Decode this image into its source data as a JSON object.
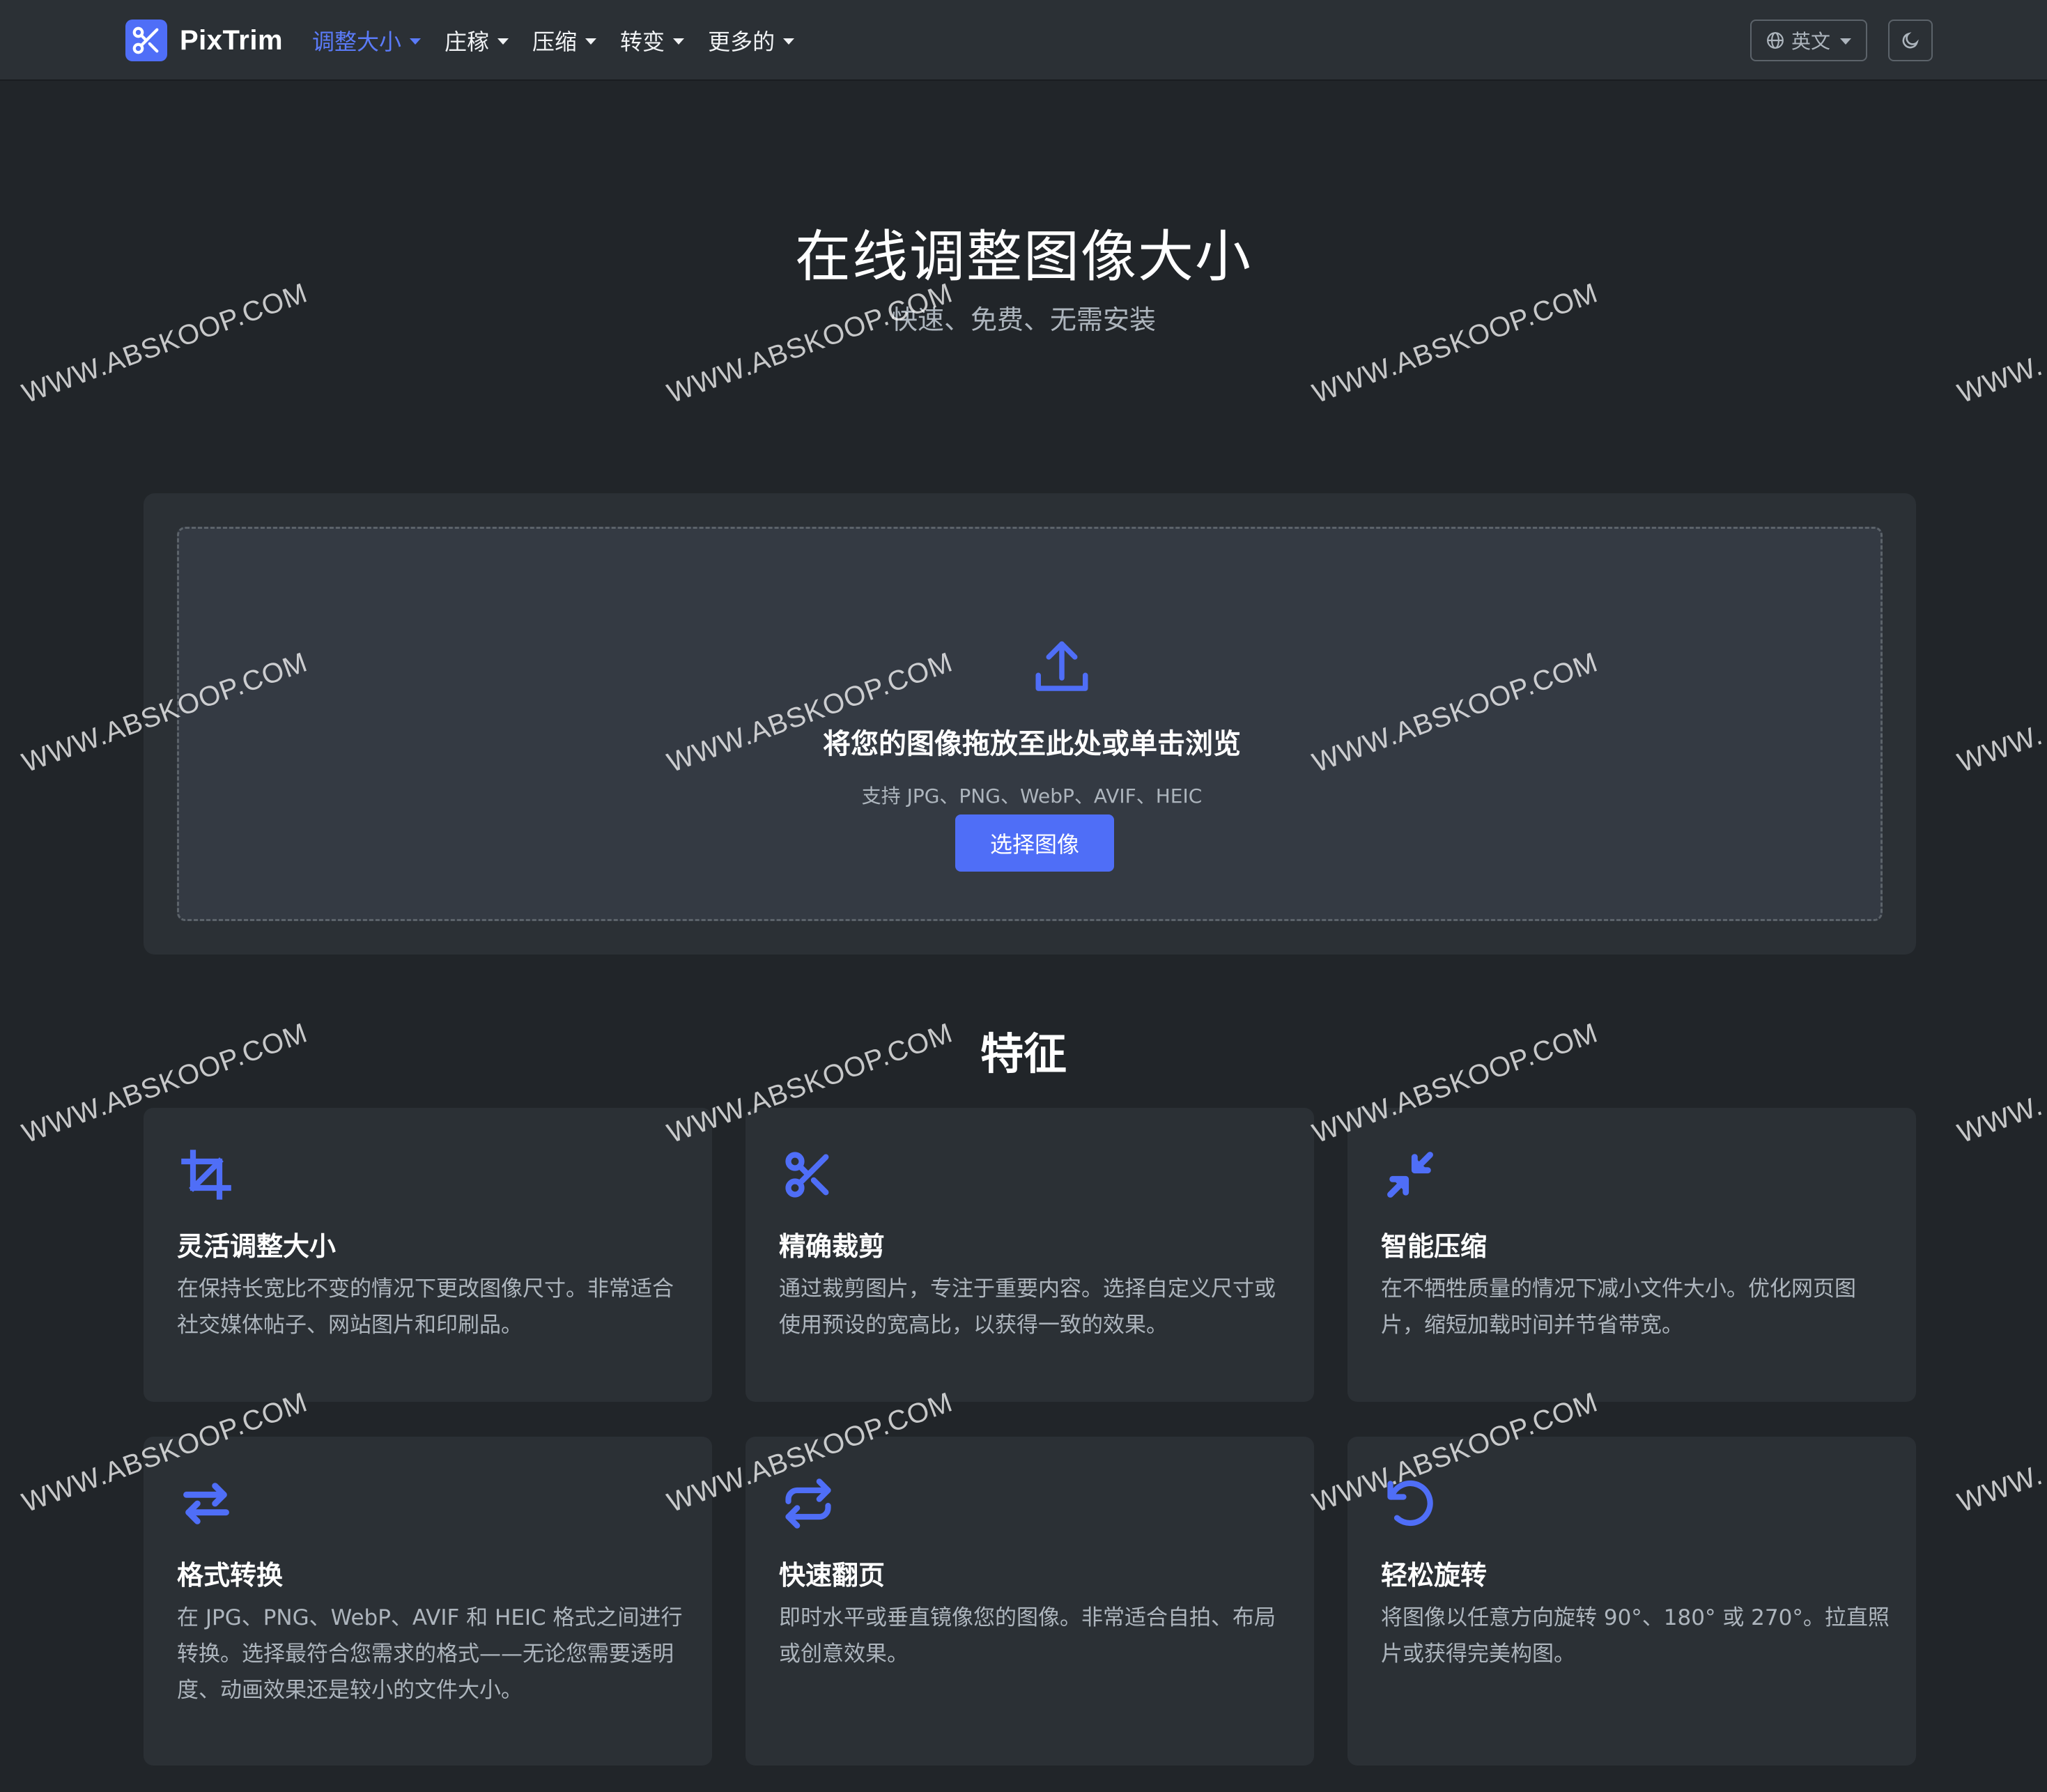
{
  "navbar": {
    "brand": "PixTrim",
    "menu": [
      {
        "label": "调整大小",
        "active": true
      },
      {
        "label": "庄稼",
        "active": false
      },
      {
        "label": "压缩",
        "active": false
      },
      {
        "label": "转变",
        "active": false
      },
      {
        "label": "更多的",
        "active": false
      }
    ],
    "language": "英文",
    "theme_icon": "moon-icon"
  },
  "hero": {
    "title": "在线调整图像大小",
    "subtitle": "快速、免费、无需安装"
  },
  "upload": {
    "icon": "upload-icon",
    "title": "将您的图像拖放至此处或单击浏览",
    "hint": "支持 JPG、PNG、WebP、AVIF、HEIC",
    "button": "选择图像"
  },
  "features": {
    "heading": "特征",
    "items": [
      {
        "icon": "crop-icon",
        "title": "灵活调整大小",
        "description": "在保持长宽比不变的情况下更改图像尺寸。非常适合社交媒体帖子、网站图片和印刷品。"
      },
      {
        "icon": "scissors-icon",
        "title": "精确裁剪",
        "description": "通过裁剪图片，专注于重要内容。选择自定义尺寸或使用预设的宽高比，以获得一致的效果。"
      },
      {
        "icon": "compress-icon",
        "title": "智能压缩",
        "description": "在不牺牲质量的情况下减小文件大小。优化网页图片，缩短加载时间并节省带宽。"
      },
      {
        "icon": "swap-arrows-icon",
        "title": "格式转换",
        "description": "在 JPG、PNG、WebP、AVIF 和 HEIC 格式之间进行转换。选择最符合您需求的格式——无论您需要透明度、动画效果还是较小的文件大小。"
      },
      {
        "icon": "flip-icon",
        "title": "快速翻页",
        "description": "即时水平或垂直镜像您的图像。非常适合自拍、布局或创意效果。"
      },
      {
        "icon": "rotate-icon",
        "title": "轻松旋转",
        "description": "将图像以任意方向旋转 90°、180° 或 270°。拉直照片或获得完美构图。"
      }
    ]
  },
  "watermark": {
    "text": "WWW.ABSKOOP.COM",
    "partial": "WWW."
  },
  "colors": {
    "accent": "#4f6ef7",
    "background": "#212529",
    "card": "#2b3035"
  }
}
